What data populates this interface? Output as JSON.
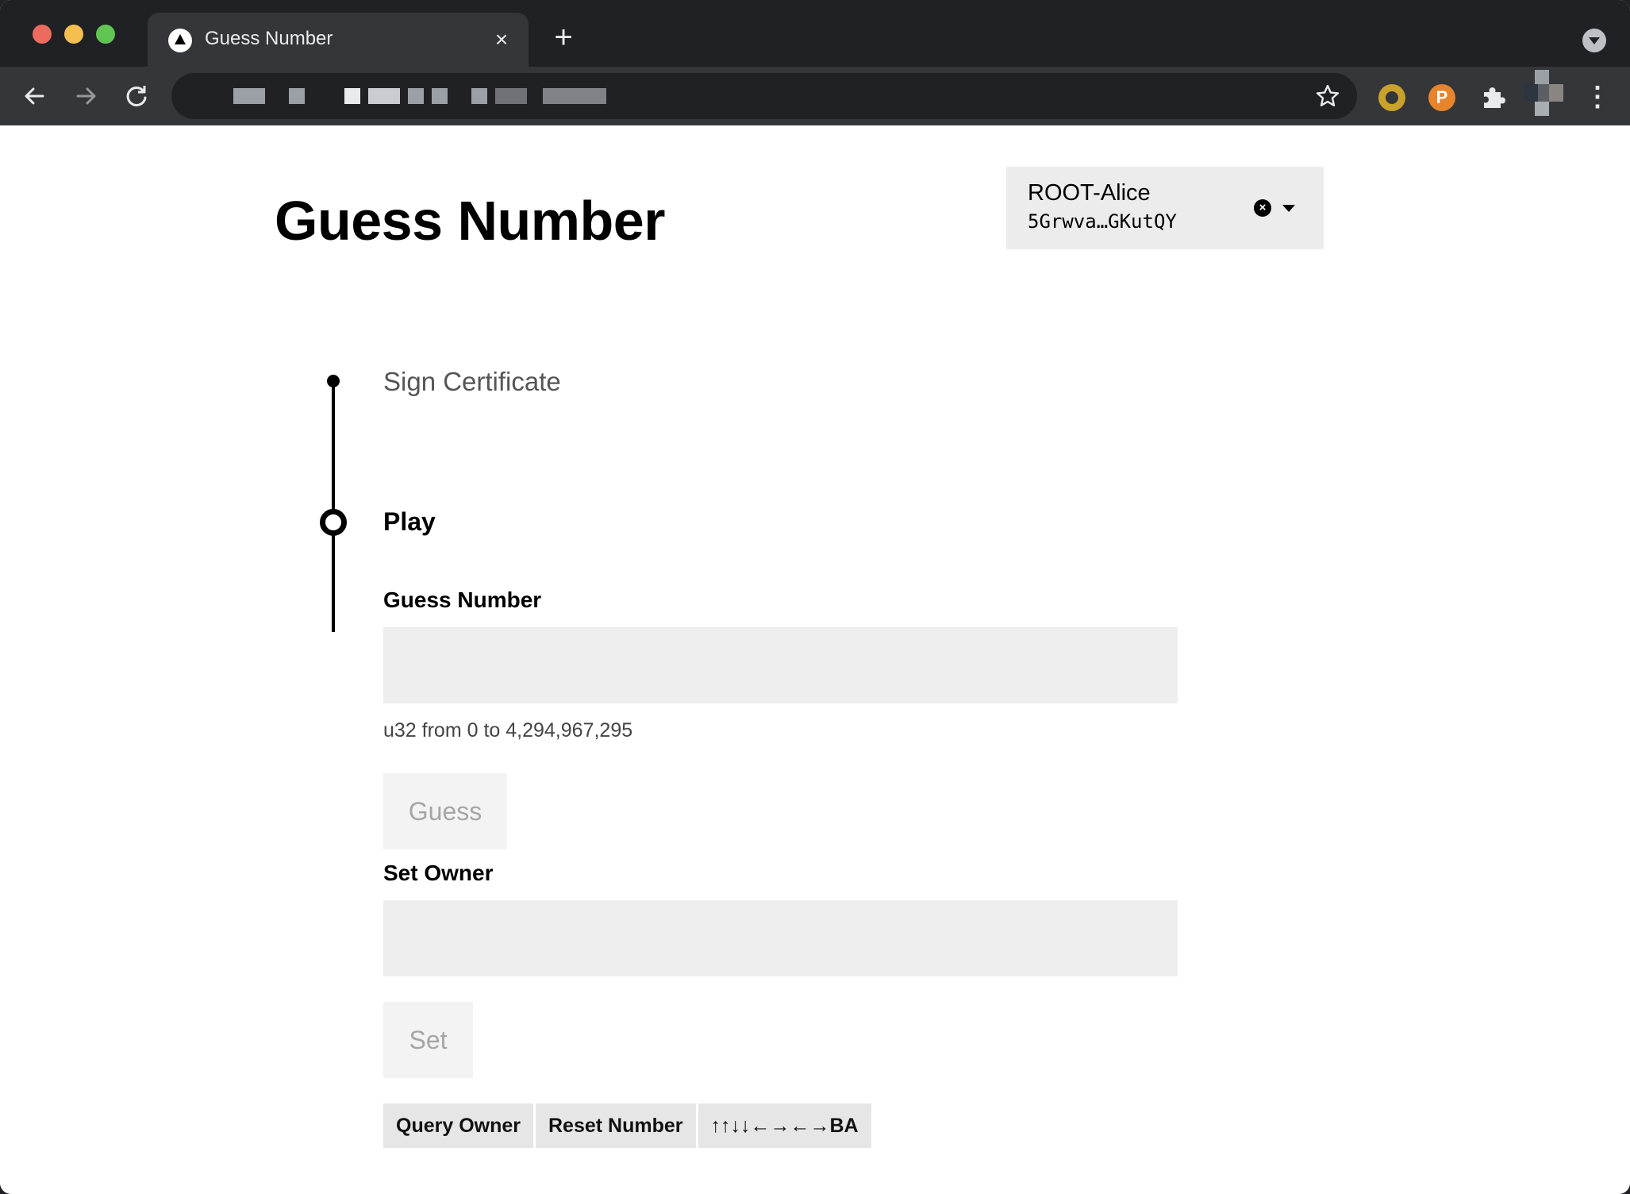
{
  "browser": {
    "tab_title": "Guess Number",
    "tab_close": "×",
    "new_tab": "+",
    "menu": "⋮",
    "extension_letter": "P"
  },
  "page": {
    "title": "Guess Number",
    "account": {
      "name": "ROOT-Alice",
      "address": "5Grwva…GKutQY",
      "clear": "×"
    },
    "steps": [
      {
        "label": "Sign Certificate",
        "state": "completed"
      },
      {
        "label": "Play",
        "state": "active"
      }
    ],
    "guess": {
      "label": "Guess Number",
      "value": "",
      "hint": "u32 from 0 to 4,294,967,295",
      "button": "Guess"
    },
    "set_owner": {
      "label": "Set Owner",
      "value": "",
      "button": "Set"
    },
    "actions": [
      "Query Owner",
      "Reset Number",
      "↑↑↓↓←→←→BA"
    ]
  }
}
